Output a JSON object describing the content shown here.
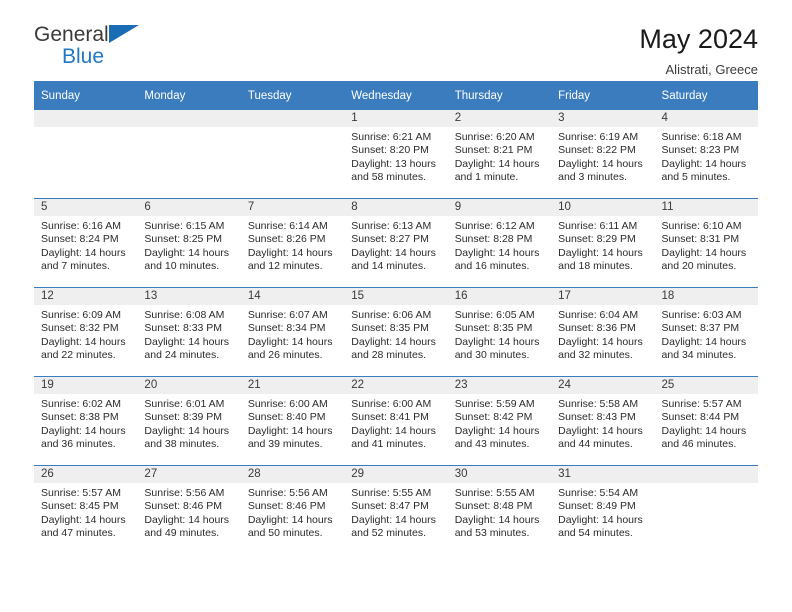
{
  "logo": {
    "line1": "General",
    "line2": "Blue",
    "triangle_icon": "blue-triangle",
    "blue": "#2079c4"
  },
  "header": {
    "title": "May 2024",
    "subtitle": "Alistrati, Greece"
  },
  "colors": {
    "header_blue": "#3a7cbe",
    "daynum_band": "#efefef"
  },
  "weekdays": [
    "Sunday",
    "Monday",
    "Tuesday",
    "Wednesday",
    "Thursday",
    "Friday",
    "Saturday"
  ],
  "labels": {
    "sunrise": "Sunrise:",
    "sunset": "Sunset:",
    "daylight": "Daylight:"
  },
  "weeks": [
    [
      {
        "day": "",
        "sunrise": "",
        "sunset": "",
        "daylight1": "",
        "daylight2": ""
      },
      {
        "day": "",
        "sunrise": "",
        "sunset": "",
        "daylight1": "",
        "daylight2": ""
      },
      {
        "day": "",
        "sunrise": "",
        "sunset": "",
        "daylight1": "",
        "daylight2": ""
      },
      {
        "day": "1",
        "sunrise": "Sunrise: 6:21 AM",
        "sunset": "Sunset: 8:20 PM",
        "daylight1": "Daylight: 13 hours",
        "daylight2": "and 58 minutes."
      },
      {
        "day": "2",
        "sunrise": "Sunrise: 6:20 AM",
        "sunset": "Sunset: 8:21 PM",
        "daylight1": "Daylight: 14 hours",
        "daylight2": "and 1 minute."
      },
      {
        "day": "3",
        "sunrise": "Sunrise: 6:19 AM",
        "sunset": "Sunset: 8:22 PM",
        "daylight1": "Daylight: 14 hours",
        "daylight2": "and 3 minutes."
      },
      {
        "day": "4",
        "sunrise": "Sunrise: 6:18 AM",
        "sunset": "Sunset: 8:23 PM",
        "daylight1": "Daylight: 14 hours",
        "daylight2": "and 5 minutes."
      }
    ],
    [
      {
        "day": "5",
        "sunrise": "Sunrise: 6:16 AM",
        "sunset": "Sunset: 8:24 PM",
        "daylight1": "Daylight: 14 hours",
        "daylight2": "and 7 minutes."
      },
      {
        "day": "6",
        "sunrise": "Sunrise: 6:15 AM",
        "sunset": "Sunset: 8:25 PM",
        "daylight1": "Daylight: 14 hours",
        "daylight2": "and 10 minutes."
      },
      {
        "day": "7",
        "sunrise": "Sunrise: 6:14 AM",
        "sunset": "Sunset: 8:26 PM",
        "daylight1": "Daylight: 14 hours",
        "daylight2": "and 12 minutes."
      },
      {
        "day": "8",
        "sunrise": "Sunrise: 6:13 AM",
        "sunset": "Sunset: 8:27 PM",
        "daylight1": "Daylight: 14 hours",
        "daylight2": "and 14 minutes."
      },
      {
        "day": "9",
        "sunrise": "Sunrise: 6:12 AM",
        "sunset": "Sunset: 8:28 PM",
        "daylight1": "Daylight: 14 hours",
        "daylight2": "and 16 minutes."
      },
      {
        "day": "10",
        "sunrise": "Sunrise: 6:11 AM",
        "sunset": "Sunset: 8:29 PM",
        "daylight1": "Daylight: 14 hours",
        "daylight2": "and 18 minutes."
      },
      {
        "day": "11",
        "sunrise": "Sunrise: 6:10 AM",
        "sunset": "Sunset: 8:31 PM",
        "daylight1": "Daylight: 14 hours",
        "daylight2": "and 20 minutes."
      }
    ],
    [
      {
        "day": "12",
        "sunrise": "Sunrise: 6:09 AM",
        "sunset": "Sunset: 8:32 PM",
        "daylight1": "Daylight: 14 hours",
        "daylight2": "and 22 minutes."
      },
      {
        "day": "13",
        "sunrise": "Sunrise: 6:08 AM",
        "sunset": "Sunset: 8:33 PM",
        "daylight1": "Daylight: 14 hours",
        "daylight2": "and 24 minutes."
      },
      {
        "day": "14",
        "sunrise": "Sunrise: 6:07 AM",
        "sunset": "Sunset: 8:34 PM",
        "daylight1": "Daylight: 14 hours",
        "daylight2": "and 26 minutes."
      },
      {
        "day": "15",
        "sunrise": "Sunrise: 6:06 AM",
        "sunset": "Sunset: 8:35 PM",
        "daylight1": "Daylight: 14 hours",
        "daylight2": "and 28 minutes."
      },
      {
        "day": "16",
        "sunrise": "Sunrise: 6:05 AM",
        "sunset": "Sunset: 8:35 PM",
        "daylight1": "Daylight: 14 hours",
        "daylight2": "and 30 minutes."
      },
      {
        "day": "17",
        "sunrise": "Sunrise: 6:04 AM",
        "sunset": "Sunset: 8:36 PM",
        "daylight1": "Daylight: 14 hours",
        "daylight2": "and 32 minutes."
      },
      {
        "day": "18",
        "sunrise": "Sunrise: 6:03 AM",
        "sunset": "Sunset: 8:37 PM",
        "daylight1": "Daylight: 14 hours",
        "daylight2": "and 34 minutes."
      }
    ],
    [
      {
        "day": "19",
        "sunrise": "Sunrise: 6:02 AM",
        "sunset": "Sunset: 8:38 PM",
        "daylight1": "Daylight: 14 hours",
        "daylight2": "and 36 minutes."
      },
      {
        "day": "20",
        "sunrise": "Sunrise: 6:01 AM",
        "sunset": "Sunset: 8:39 PM",
        "daylight1": "Daylight: 14 hours",
        "daylight2": "and 38 minutes."
      },
      {
        "day": "21",
        "sunrise": "Sunrise: 6:00 AM",
        "sunset": "Sunset: 8:40 PM",
        "daylight1": "Daylight: 14 hours",
        "daylight2": "and 39 minutes."
      },
      {
        "day": "22",
        "sunrise": "Sunrise: 6:00 AM",
        "sunset": "Sunset: 8:41 PM",
        "daylight1": "Daylight: 14 hours",
        "daylight2": "and 41 minutes."
      },
      {
        "day": "23",
        "sunrise": "Sunrise: 5:59 AM",
        "sunset": "Sunset: 8:42 PM",
        "daylight1": "Daylight: 14 hours",
        "daylight2": "and 43 minutes."
      },
      {
        "day": "24",
        "sunrise": "Sunrise: 5:58 AM",
        "sunset": "Sunset: 8:43 PM",
        "daylight1": "Daylight: 14 hours",
        "daylight2": "and 44 minutes."
      },
      {
        "day": "25",
        "sunrise": "Sunrise: 5:57 AM",
        "sunset": "Sunset: 8:44 PM",
        "daylight1": "Daylight: 14 hours",
        "daylight2": "and 46 minutes."
      }
    ],
    [
      {
        "day": "26",
        "sunrise": "Sunrise: 5:57 AM",
        "sunset": "Sunset: 8:45 PM",
        "daylight1": "Daylight: 14 hours",
        "daylight2": "and 47 minutes."
      },
      {
        "day": "27",
        "sunrise": "Sunrise: 5:56 AM",
        "sunset": "Sunset: 8:46 PM",
        "daylight1": "Daylight: 14 hours",
        "daylight2": "and 49 minutes."
      },
      {
        "day": "28",
        "sunrise": "Sunrise: 5:56 AM",
        "sunset": "Sunset: 8:46 PM",
        "daylight1": "Daylight: 14 hours",
        "daylight2": "and 50 minutes."
      },
      {
        "day": "29",
        "sunrise": "Sunrise: 5:55 AM",
        "sunset": "Sunset: 8:47 PM",
        "daylight1": "Daylight: 14 hours",
        "daylight2": "and 52 minutes."
      },
      {
        "day": "30",
        "sunrise": "Sunrise: 5:55 AM",
        "sunset": "Sunset: 8:48 PM",
        "daylight1": "Daylight: 14 hours",
        "daylight2": "and 53 minutes."
      },
      {
        "day": "31",
        "sunrise": "Sunrise: 5:54 AM",
        "sunset": "Sunset: 8:49 PM",
        "daylight1": "Daylight: 14 hours",
        "daylight2": "and 54 minutes."
      },
      {
        "day": "",
        "sunrise": "",
        "sunset": "",
        "daylight1": "",
        "daylight2": ""
      }
    ]
  ]
}
